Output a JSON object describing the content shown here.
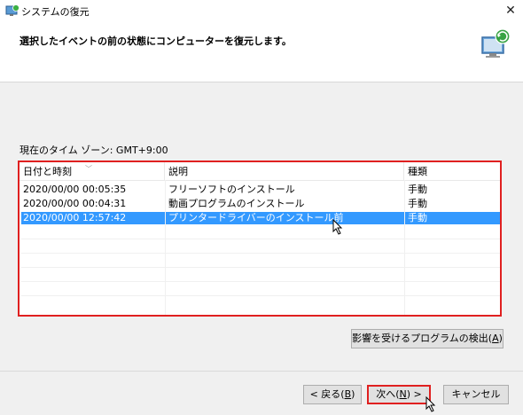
{
  "window": {
    "title": "システムの復元",
    "close_glyph": "✕",
    "app_icon": "system-restore-icon"
  },
  "header": {
    "instruction": "選択したイベントの前の状態にコンピューターを復元します。",
    "graphic_icon": "restore-monitor-icon"
  },
  "timezone_label": "現在のタイム ゾーン: GMT+9:00",
  "table": {
    "columns": [
      "日付と時刻",
      "説明",
      "種類"
    ],
    "rows": [
      {
        "date": "2020/00/00 00:05:35",
        "description": "フリーソフトのインストール",
        "type": "手動",
        "selected": false
      },
      {
        "date": "2020/00/00 00:04:31",
        "description": "動画プログラムのインストール",
        "type": "手動",
        "selected": false
      },
      {
        "date": "2020/00/00 12:57:42",
        "description": "プリンタードライバーのインストール前",
        "type": "手動",
        "selected": true
      }
    ]
  },
  "buttons": {
    "scan_prefix": "影響を受けるプログラムの検出(",
    "scan_key": "A",
    "scan_suffix": ")",
    "back_prefix": "< 戻る(",
    "back_key": "B",
    "back_suffix": ")",
    "next_prefix": "次へ(",
    "next_key": "N",
    "next_suffix": ") >",
    "cancel": "キャンセル"
  },
  "colors": {
    "selection": "#3399ff",
    "highlight_border": "#e02020"
  }
}
